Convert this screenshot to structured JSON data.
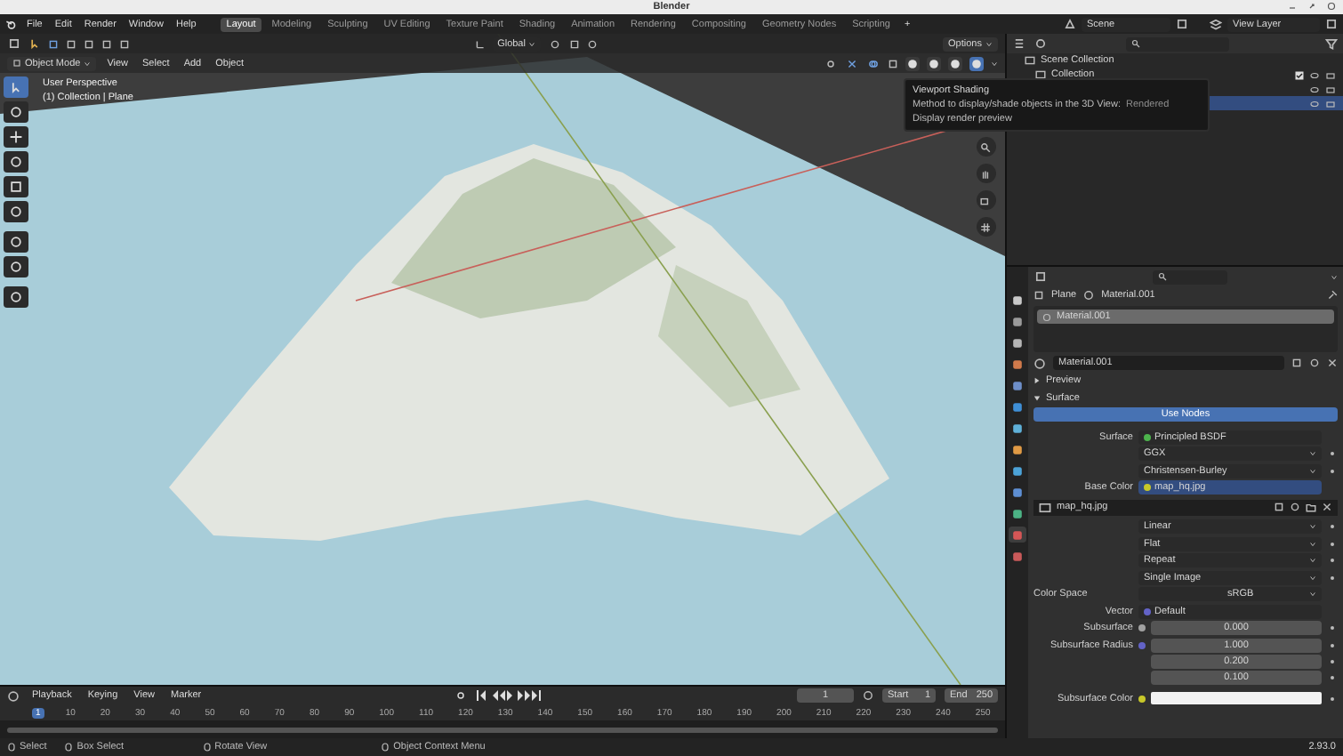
{
  "window": {
    "title": "Blender"
  },
  "menu": [
    "File",
    "Edit",
    "Render",
    "Window",
    "Help"
  ],
  "workspaces": [
    {
      "label": "Layout",
      "selected": true
    },
    {
      "label": "Modeling",
      "selected": false
    },
    {
      "label": "Sculpting",
      "selected": false
    },
    {
      "label": "UV Editing",
      "selected": false
    },
    {
      "label": "Texture Paint",
      "selected": false
    },
    {
      "label": "Shading",
      "selected": false
    },
    {
      "label": "Animation",
      "selected": false
    },
    {
      "label": "Rendering",
      "selected": false
    },
    {
      "label": "Compositing",
      "selected": false
    },
    {
      "label": "Geometry Nodes",
      "selected": false
    },
    {
      "label": "Scripting",
      "selected": false
    }
  ],
  "add_workspace": "+",
  "scene": {
    "name": "Scene",
    "view_layer": "View Layer"
  },
  "viewport": {
    "orientation": "Global",
    "options": "Options",
    "mode": "Object Mode",
    "menus": [
      "View",
      "Select",
      "Add",
      "Object"
    ],
    "shading": [
      {
        "selected": false
      },
      {
        "selected": false
      },
      {
        "selected": false
      },
      {
        "selected": true
      }
    ],
    "overlay": [
      "User Perspective",
      "(1) Collection | Plane"
    ],
    "tools": [
      {
        "selected": true
      },
      {
        "selected": false
      },
      {
        "selected": false
      },
      {
        "selected": false
      },
      {
        "selected": false
      },
      {
        "selected": false
      },
      {
        "selected": false
      },
      {
        "selected": false
      },
      {
        "selected": false
      }
    ],
    "tooltip": {
      "title": "Viewport Shading",
      "description": "Method to display/shade objects in the 3D View:",
      "value": "Rendered",
      "detail": "Display render preview"
    }
  },
  "outliner": {
    "rows": [
      {
        "label": "Scene Collection",
        "selected": false
      },
      {
        "label": "Collection",
        "selected": false,
        "checked": true
      }
    ],
    "covered_rows": [
      {
        "selected": false
      },
      {
        "selected": true
      }
    ]
  },
  "properties": {
    "tabs": [
      {
        "color": "#c8c8c8",
        "selected": false
      },
      {
        "color": "#9a9a9a",
        "selected": false
      },
      {
        "color": "#b5b5b5",
        "selected": false
      },
      {
        "color": "#d07a4b",
        "selected": false
      },
      {
        "color": "#6e8fc9",
        "selected": false
      },
      {
        "color": "#3f8fd6",
        "selected": false
      },
      {
        "color": "#5fb0d8",
        "selected": false
      },
      {
        "color": "#e09a45",
        "selected": false
      },
      {
        "color": "#4ca3d8",
        "selected": false
      },
      {
        "color": "#5e8fd3",
        "selected": false
      },
      {
        "color": "#4cb385",
        "selected": false
      },
      {
        "color": "#d65656",
        "selected": true
      },
      {
        "color": "#c95a5a",
        "selected": false
      }
    ],
    "breadcrumb": [
      "Plane",
      "Material.001"
    ],
    "slots": [
      {
        "label": "Material.001",
        "selected": true
      }
    ],
    "material": "Material.001",
    "sections": [
      {
        "label": "Preview",
        "expanded": false
      },
      {
        "label": "Surface",
        "expanded": true
      }
    ],
    "use_nodes": "Use Nodes",
    "rows": [
      {
        "kind": "socket",
        "label": "Surface",
        "value": "Principled BSDF",
        "color": "#4cb34c",
        "highlighted": false
      },
      {
        "kind": "dropdown",
        "value": "GGX"
      },
      {
        "kind": "dropdown",
        "value": "Christensen-Burley"
      },
      {
        "kind": "socket",
        "label": "Base Color",
        "value": "map_hq.jpg",
        "color": "#c7c729",
        "highlighted": true
      },
      {
        "kind": "image",
        "value": "map_hq.jpg"
      },
      {
        "kind": "dropdown",
        "value": "Linear"
      },
      {
        "kind": "dropdown",
        "value": "Flat"
      },
      {
        "kind": "dropdown",
        "value": "Repeat"
      },
      {
        "kind": "dropdown",
        "value": "Single Image"
      },
      {
        "kind": "select",
        "label": "Color Space",
        "value": "sRGB"
      },
      {
        "kind": "socket",
        "label": "Vector",
        "value": "Default",
        "color": "#6363c7",
        "highlighted": false
      },
      {
        "kind": "number",
        "label": "Subsurface",
        "values": [
          "0.000"
        ],
        "color": "#a1a1a1"
      },
      {
        "kind": "number",
        "label": "Subsurface Radius",
        "values": [
          "1.000",
          "0.200",
          "0.100"
        ],
        "color": "#6363c7"
      },
      {
        "kind": "color",
        "label": "Subsurface Color",
        "color": "#c7c729"
      }
    ]
  },
  "timeline": {
    "menus": [
      "Playback",
      "Keying",
      "View",
      "Marker"
    ],
    "current_frame": "1",
    "start_label": "Start",
    "start": "1",
    "end_label": "End",
    "end": "250",
    "ticks": [
      {
        "label": "1",
        "selected": true
      },
      {
        "label": "10",
        "selected": false
      },
      {
        "label": "20",
        "selected": false
      },
      {
        "label": "30",
        "selected": false
      },
      {
        "label": "40",
        "selected": false
      },
      {
        "label": "50",
        "selected": false
      },
      {
        "label": "60",
        "selected": false
      },
      {
        "label": "70",
        "selected": false
      },
      {
        "label": "80",
        "selected": false
      },
      {
        "label": "90",
        "selected": false
      },
      {
        "label": "100",
        "selected": false
      },
      {
        "label": "110",
        "selected": false
      },
      {
        "label": "120",
        "selected": false
      },
      {
        "label": "130",
        "selected": false
      },
      {
        "label": "140",
        "selected": false
      },
      {
        "label": "150",
        "selected": false
      },
      {
        "label": "160",
        "selected": false
      },
      {
        "label": "170",
        "selected": false
      },
      {
        "label": "180",
        "selected": false
      },
      {
        "label": "190",
        "selected": false
      },
      {
        "label": "200",
        "selected": false
      },
      {
        "label": "210",
        "selected": false
      },
      {
        "label": "220",
        "selected": false
      },
      {
        "label": "230",
        "selected": false
      },
      {
        "label": "240",
        "selected": false
      },
      {
        "label": "250",
        "selected": false
      }
    ]
  },
  "status_bar": {
    "items": [
      "Select",
      "Box Select",
      "Rotate View",
      "Object Context Menu"
    ],
    "version": "2.93.0"
  }
}
